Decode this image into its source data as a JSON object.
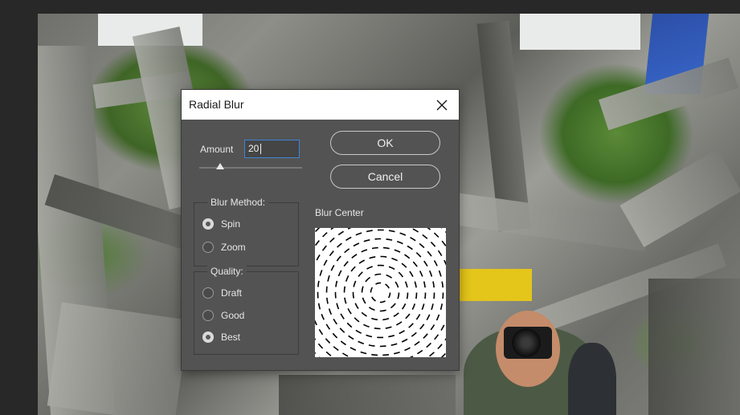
{
  "dialog": {
    "title": "Radial Blur",
    "amount": {
      "label": "Amount",
      "value": "20",
      "slider_fraction": 0.2
    },
    "buttons": {
      "ok": "OK",
      "cancel": "Cancel"
    },
    "blur_method": {
      "legend": "Blur Method:",
      "options": [
        "Spin",
        "Zoom"
      ],
      "selected": "Spin"
    },
    "quality": {
      "legend": "Quality:",
      "options": [
        "Draft",
        "Good",
        "Best"
      ],
      "selected": "Best"
    },
    "blur_center": {
      "label": "Blur Center"
    }
  },
  "icons": {
    "close": "close-icon"
  },
  "colors": {
    "dialog_bg": "#535353",
    "input_focus": "#3f84d6",
    "workspace": "#282828"
  }
}
